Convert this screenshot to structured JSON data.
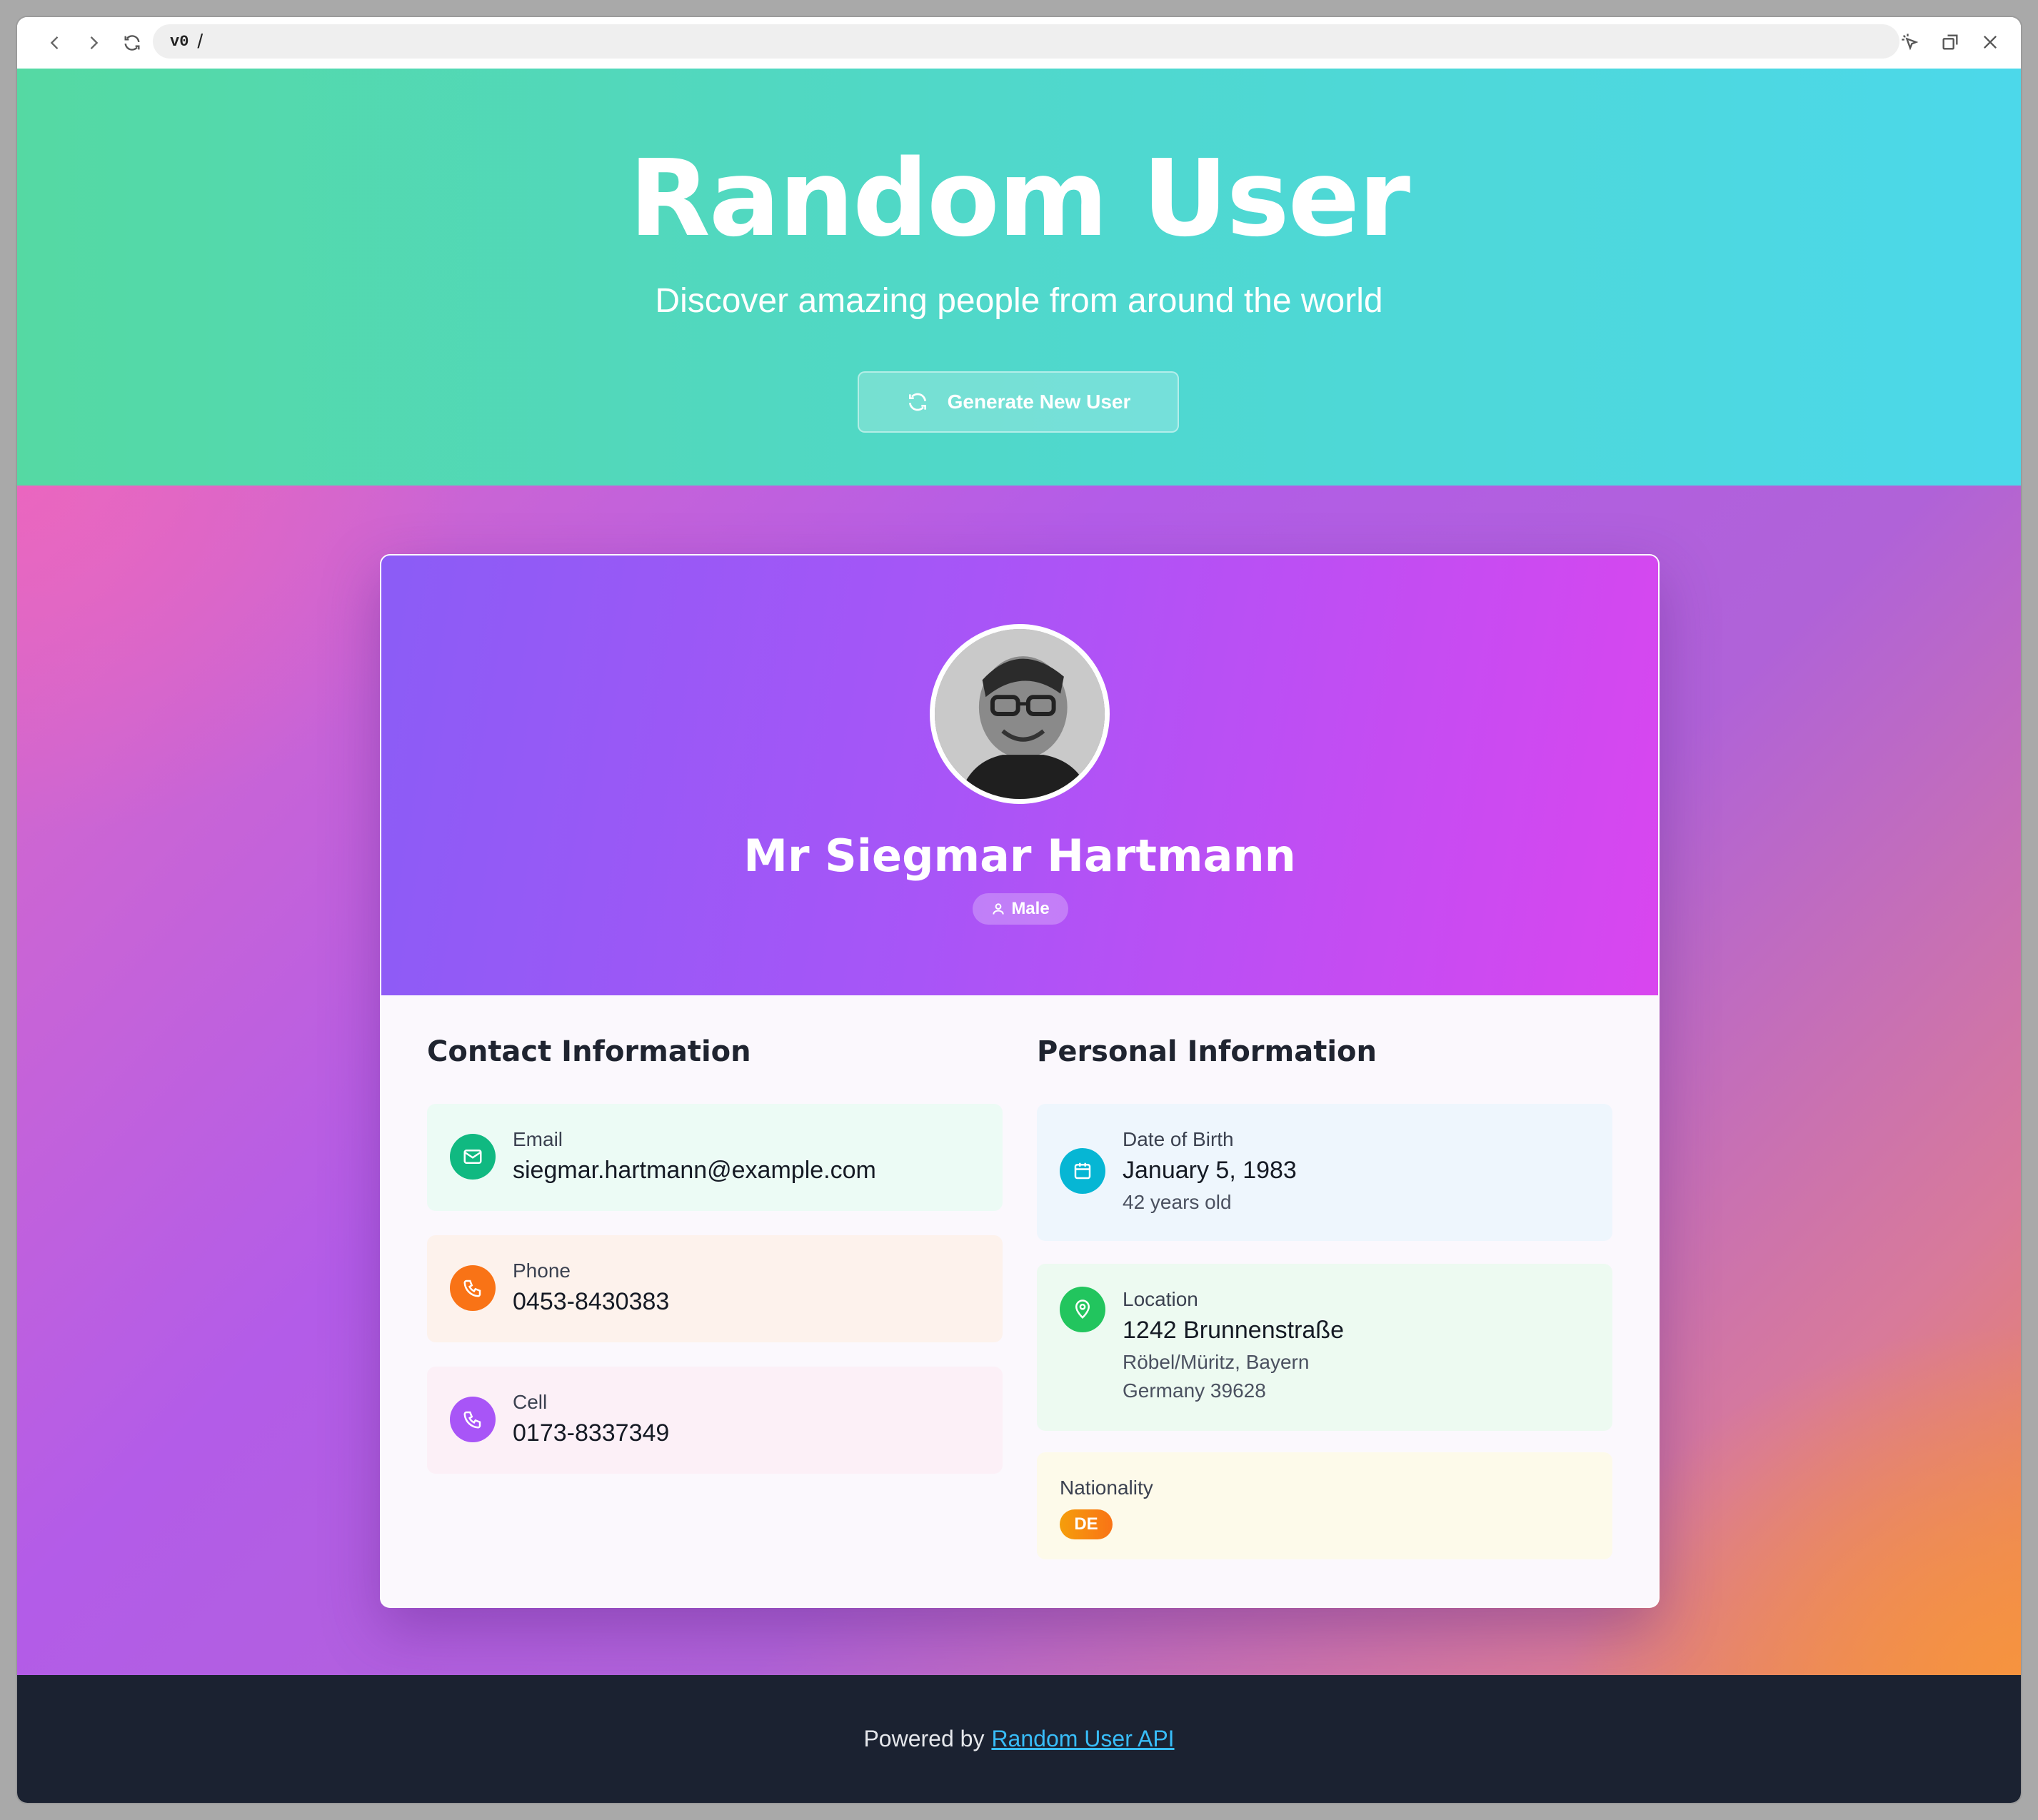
{
  "browser": {
    "url_prefix": "v0",
    "url_path": "/"
  },
  "hero": {
    "title": "Random User",
    "subtitle": "Discover amazing people from around the world",
    "generate_label": "Generate New User"
  },
  "profile": {
    "name": "Mr Siegmar Hartmann",
    "gender": "Male"
  },
  "contact": {
    "title": "Contact Information",
    "email_label": "Email",
    "email_value": "siegmar.hartmann@example.com",
    "phone_label": "Phone",
    "phone_value": "0453-8430383",
    "cell_label": "Cell",
    "cell_value": "0173-8337349"
  },
  "personal": {
    "title": "Personal Information",
    "dob_label": "Date of Birth",
    "dob_value": "January 5, 1983",
    "age_text": "42 years old",
    "location_label": "Location",
    "street": "1242 Brunnenstraße",
    "city_state": "Röbel/Müritz, Bayern",
    "country_zip": "Germany 39628",
    "nationality_label": "Nationality",
    "nationality_code": "DE"
  },
  "footer": {
    "prefix": "Powered by",
    "link_text": "Random User API"
  },
  "colors": {
    "email_icon": "#10b981",
    "phone_icon": "#f97316",
    "cell_icon": "#a855f7",
    "dob_icon": "#06b6d4",
    "location_icon": "#22c55e",
    "nationality_badge": "#f59e0b"
  }
}
